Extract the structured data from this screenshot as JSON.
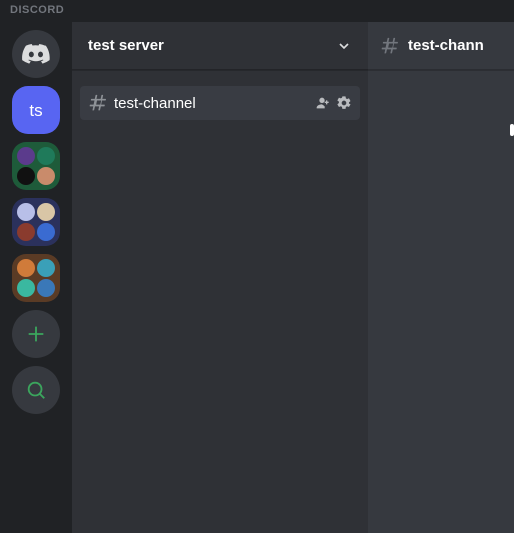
{
  "wordmark": "DISCORD",
  "servers": {
    "home_label": "Home",
    "selected_acronym": "ts",
    "add_label": "Add a Server",
    "explore_label": "Explore Servers"
  },
  "header": {
    "server_name": "test server"
  },
  "channels": {
    "selected": {
      "name": "test-channel",
      "invite_label": "Create Invite",
      "settings_label": "Edit Channel"
    }
  },
  "chat": {
    "title": "test-chann"
  },
  "colors": {
    "blurple": "#5865f2",
    "green": "#3ba55d"
  },
  "folders": [
    {
      "bg": "#1e5b3a",
      "minis": [
        "#5b3b8c",
        "#1f7a5a",
        "#111111",
        "#c98b6b"
      ]
    },
    {
      "bg": "#2b315c",
      "minis": [
        "#b8bfe8",
        "#d9c6a6",
        "#8a3b2e",
        "#3a6bd1"
      ]
    },
    {
      "bg": "#5a3b25",
      "minis": [
        "#d07b3a",
        "#3aa0b8",
        "#3ab8a0",
        "#3a78b8"
      ]
    }
  ]
}
